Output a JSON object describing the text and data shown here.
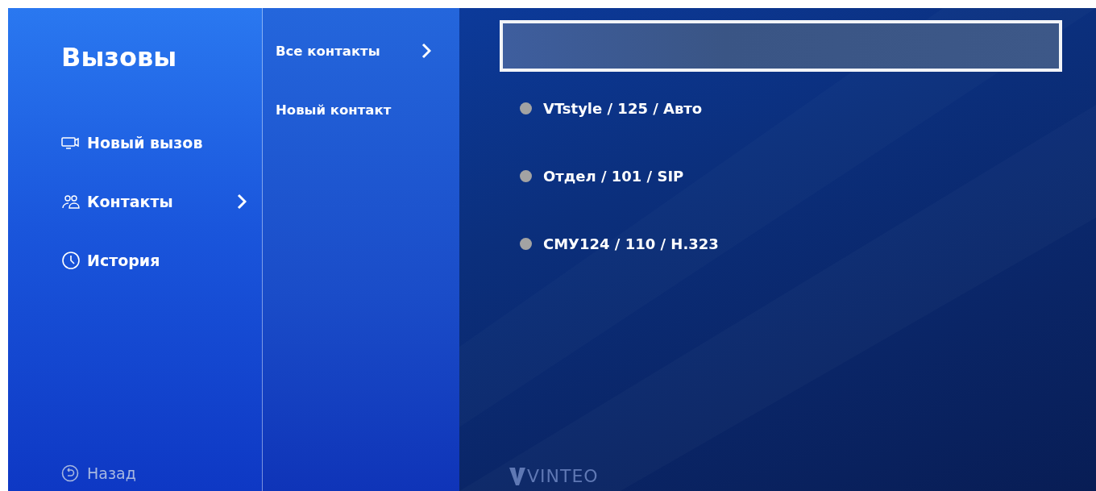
{
  "menu": {
    "title": "Вызовы",
    "items": [
      {
        "kind": "call",
        "label": "Новый вызов",
        "selected": false
      },
      {
        "kind": "contacts",
        "label": "Контакты",
        "selected": true
      },
      {
        "kind": "history",
        "label": "История",
        "selected": false
      }
    ],
    "back": {
      "label": "Назад"
    }
  },
  "submenu": {
    "items": [
      {
        "label": "Все контакты",
        "selected": true
      },
      {
        "label": "Новый контакт",
        "selected": false
      }
    ]
  },
  "contacts": {
    "search": {
      "selected": true
    },
    "items": [
      {
        "label": "VTstyle / 125 / Авто",
        "color": "#a3a3a3"
      },
      {
        "label": "Отдел / 101 / SIP",
        "color": "#a3a3a3"
      },
      {
        "label": "СМУ124 / 110 / H.323",
        "color": "#a3a3a3"
      }
    ]
  },
  "logo": "VINTEO"
}
